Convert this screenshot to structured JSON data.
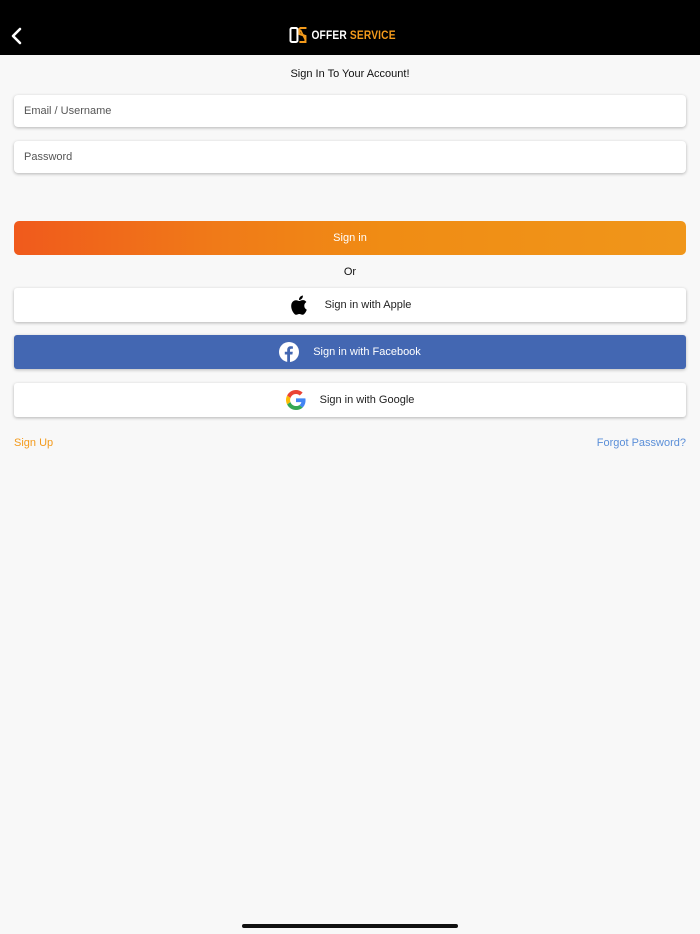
{
  "header": {
    "logo_word1": "OFFER",
    "logo_word2": "SERVICE",
    "back_icon": "chevron-left-icon"
  },
  "form": {
    "title": "Sign In To Your Account!",
    "email_placeholder": "Email / Username",
    "email_value": "",
    "password_placeholder": "Password",
    "password_value": "",
    "signin_label": "Sign in",
    "or_label": "Or"
  },
  "social": {
    "apple_label": "Sign in with Apple",
    "facebook_label": "Sign in with Facebook",
    "google_label": "Sign in with Google"
  },
  "links": {
    "signup_label": "Sign Up",
    "forgot_label": "Forgot Password?"
  },
  "colors": {
    "accent": "#f39a1b",
    "signin_gradient_start": "#f05a1c",
    "signin_gradient_end": "#f0961a",
    "facebook": "#4367b2",
    "link_blue": "#5b8fd8"
  }
}
